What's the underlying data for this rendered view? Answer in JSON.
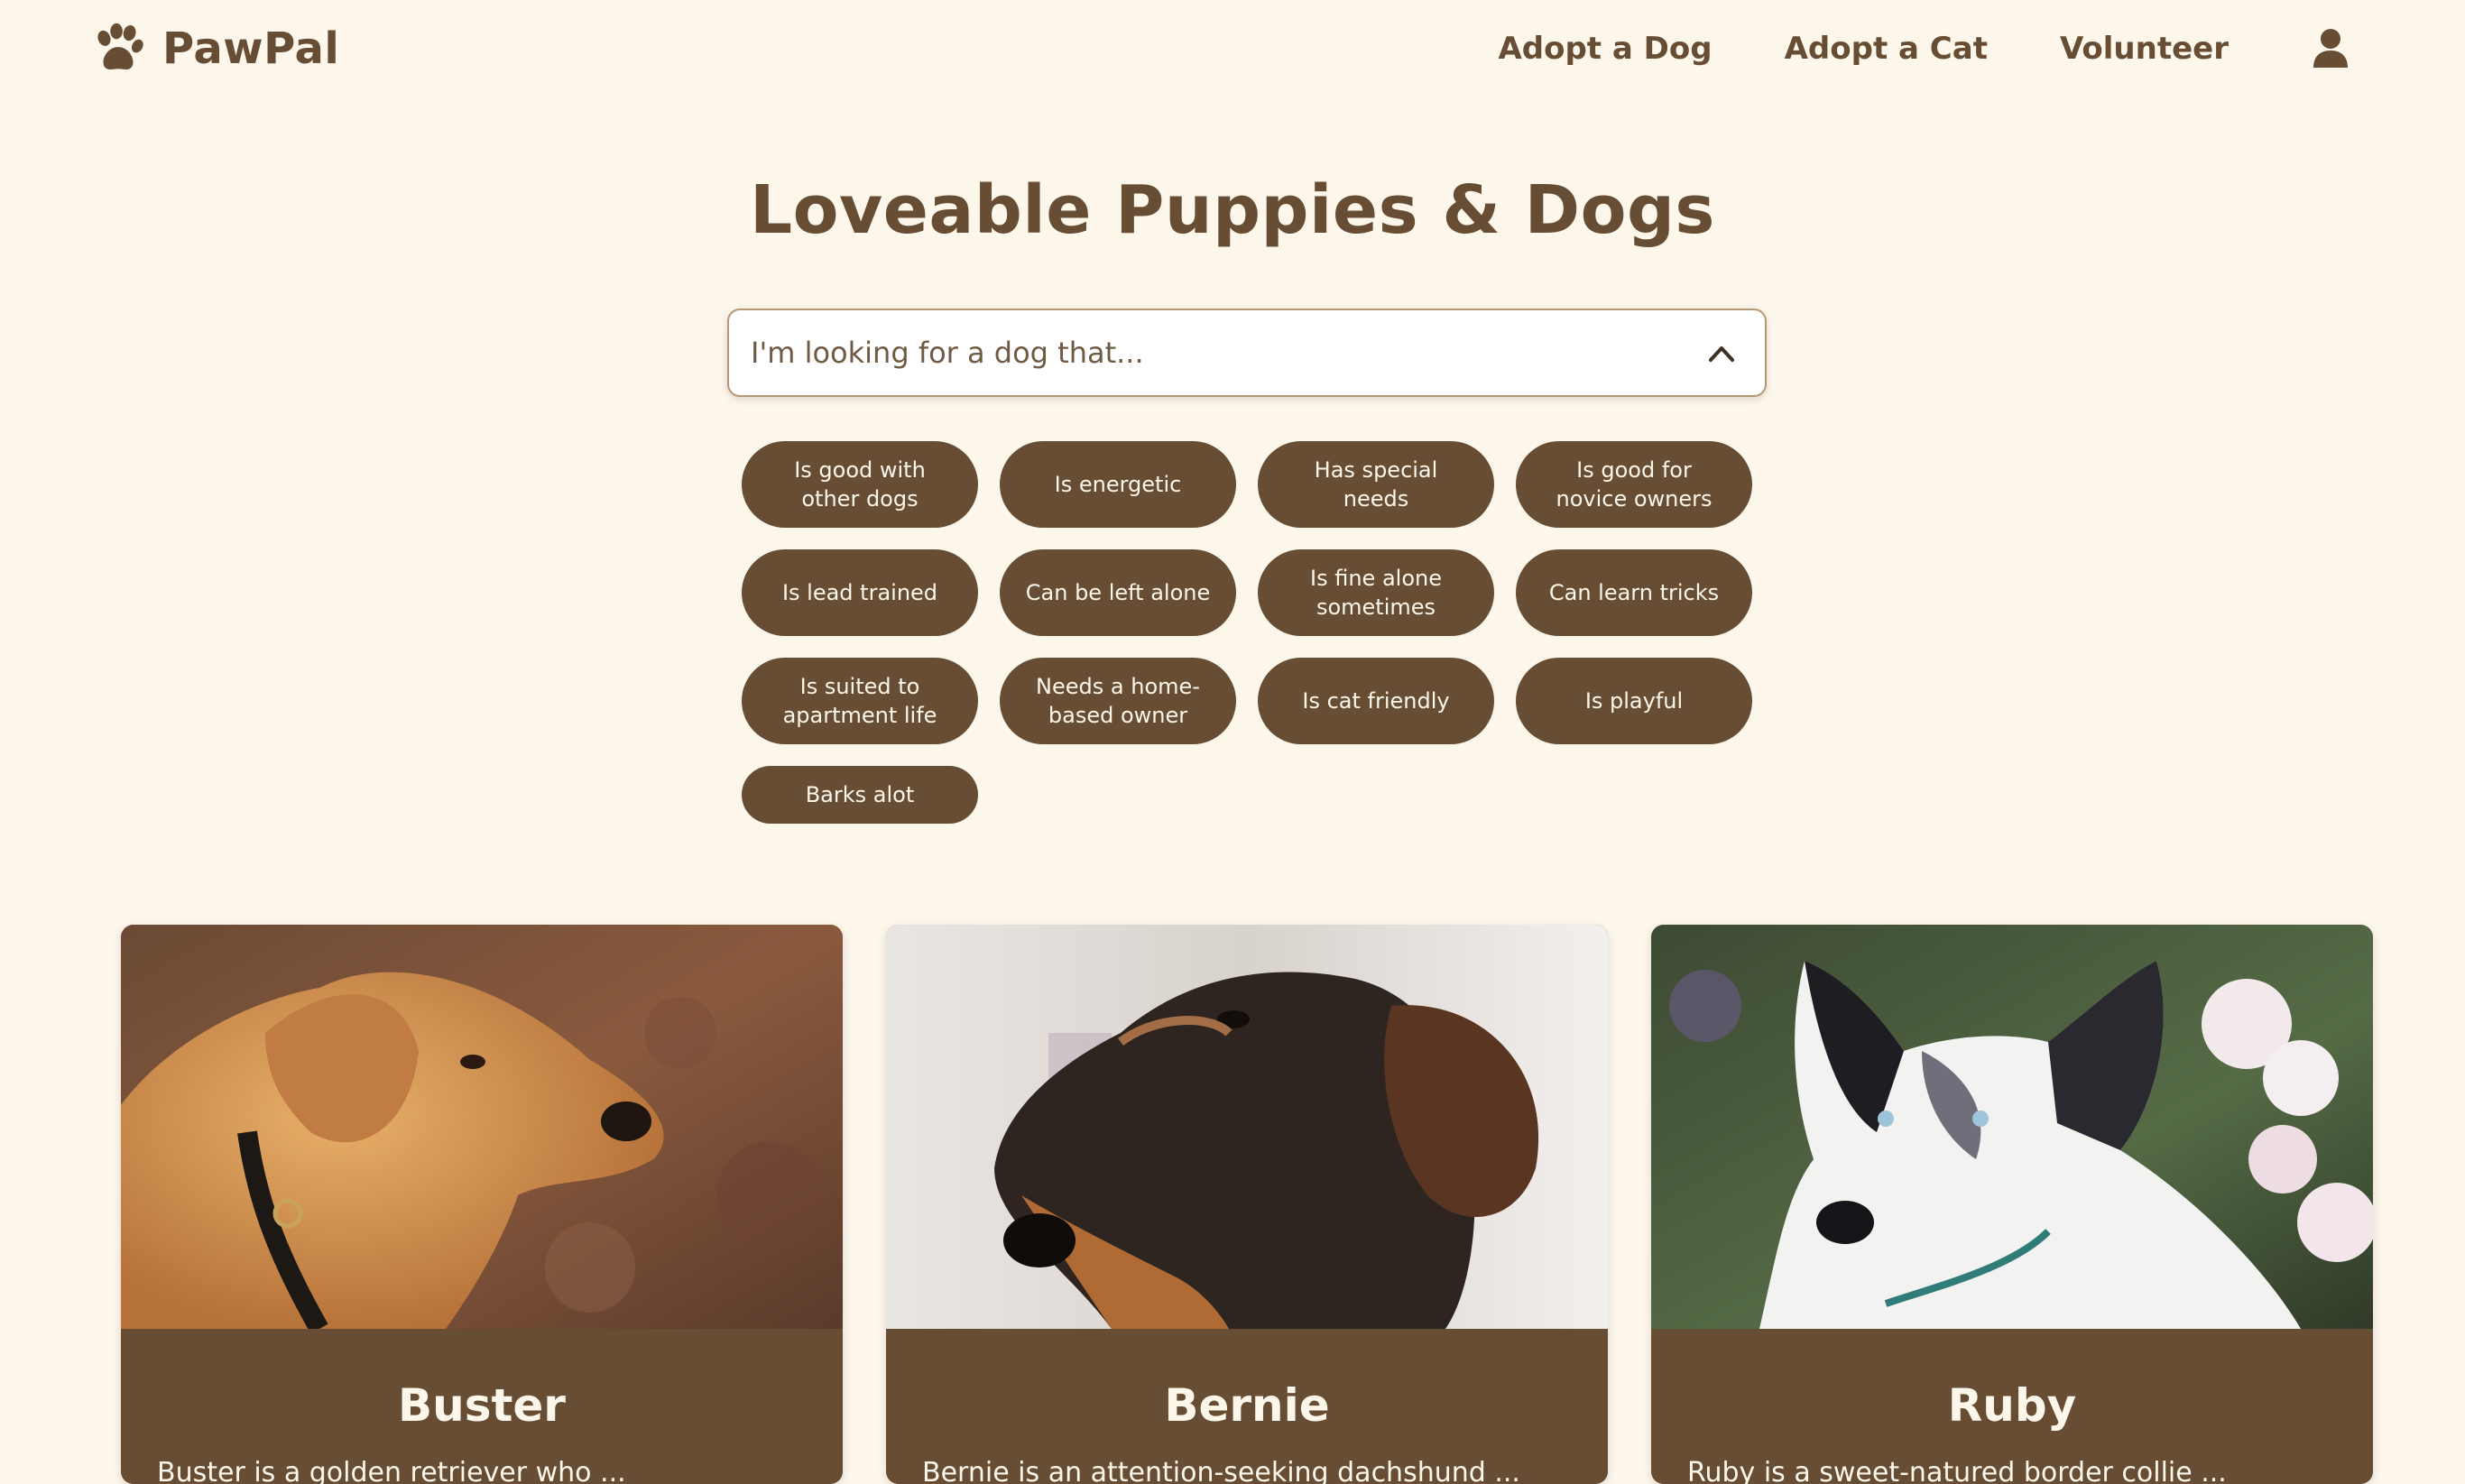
{
  "header": {
    "brand_name": "PawPal",
    "logo_icon": "paw-icon",
    "nav": [
      "Adopt a Dog",
      "Adopt a Cat",
      "Volunteer"
    ],
    "account_icon": "user-icon"
  },
  "main": {
    "title": "Loveable Puppies & Dogs",
    "search": {
      "placeholder": "I'm looking for a dog that...",
      "toggle_icon": "chevron-up-icon",
      "expanded": true
    },
    "filters": [
      "Is good with other dogs",
      "Is energetic",
      "Has special needs",
      "Is good for novice owners",
      "Is lead trained",
      "Can be left alone",
      "Is fine alone sometimes",
      "Can learn tricks",
      "Is suited to apartment life",
      "Needs a home-based owner",
      "Is cat friendly",
      "Is playful",
      "Barks alot"
    ]
  },
  "dogs": [
    {
      "name": "Buster",
      "photo": "golden retriever lying on autumn leaves",
      "description": "Buster is a golden retriever who ..."
    },
    {
      "name": "Bernie",
      "photo": "close-up of a wire-haired dachshund",
      "description": "Bernie is an attention-seeking dachshund ..."
    },
    {
      "name": "Ruby",
      "photo": "merle border collie puppy among white flowers",
      "description": "Ruby is a sweet-natured border collie ..."
    }
  ],
  "colors": {
    "background": "#fdf6eb",
    "brand_brown": "#664d33",
    "light_text": "#fdf6eb"
  }
}
